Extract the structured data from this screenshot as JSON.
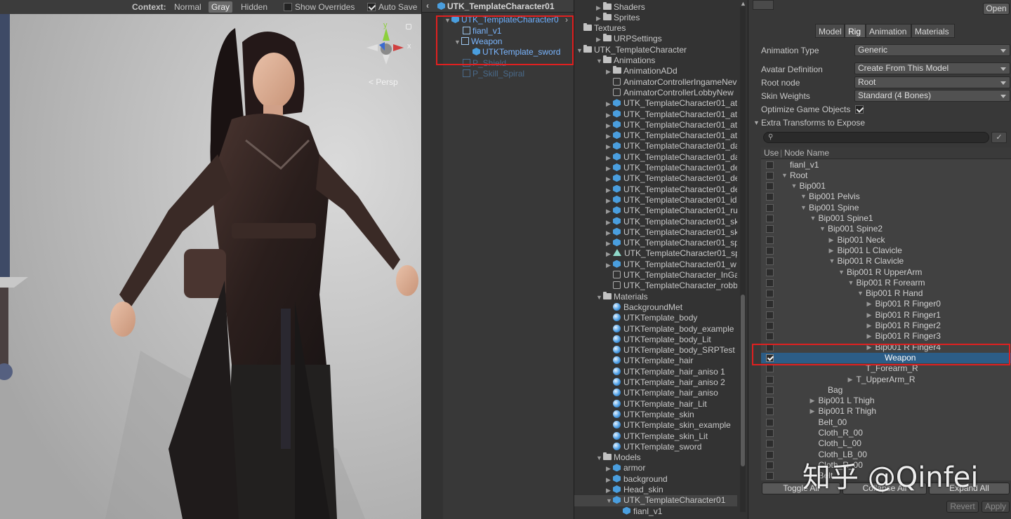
{
  "scene_toolbar": {
    "context_label": "Context:",
    "normal": "Normal",
    "gray": "Gray",
    "hidden": "Hidden",
    "show_overrides": "Show Overrides",
    "auto_save": "Auto Save"
  },
  "gizmo": {
    "x": "x",
    "y": "y",
    "persp": "< Persp"
  },
  "hierarchy": {
    "title": "UTK_TemplateCharacter01",
    "items": [
      {
        "label": "UTK_TemplateCharacter0"
      },
      {
        "label": "fianl_v1"
      },
      {
        "label": "Weapon"
      },
      {
        "label": "UTKTemplate_sword"
      },
      {
        "label": "P_Shield"
      },
      {
        "label": "P_Skill_Spiral"
      }
    ]
  },
  "project": {
    "items": [
      {
        "label": "Shaders"
      },
      {
        "label": "Sprites"
      },
      {
        "label": "Textures"
      },
      {
        "label": "URPSettings"
      },
      {
        "label": "UTK_TemplateCharacter"
      },
      {
        "label": "Animations"
      },
      {
        "label": "AnimationADd"
      },
      {
        "label": "AnimatorControllerIngameNev"
      },
      {
        "label": "AnimatorControllerLobbyNew"
      },
      {
        "label": "UTK_TemplateCharacter01_at"
      },
      {
        "label": "UTK_TemplateCharacter01_at"
      },
      {
        "label": "UTK_TemplateCharacter01_at"
      },
      {
        "label": "UTK_TemplateCharacter01_at"
      },
      {
        "label": "UTK_TemplateCharacter01_da"
      },
      {
        "label": "UTK_TemplateCharacter01_da"
      },
      {
        "label": "UTK_TemplateCharacter01_de"
      },
      {
        "label": "UTK_TemplateCharacter01_de"
      },
      {
        "label": "UTK_TemplateCharacter01_de"
      },
      {
        "label": "UTK_TemplateCharacter01_id"
      },
      {
        "label": "UTK_TemplateCharacter01_ru"
      },
      {
        "label": "UTK_TemplateCharacter01_sk"
      },
      {
        "label": "UTK_TemplateCharacter01_sk"
      },
      {
        "label": "UTK_TemplateCharacter01_sp"
      },
      {
        "label": "UTK_TemplateCharacter01_sp"
      },
      {
        "label": "UTK_TemplateCharacter01_w"
      },
      {
        "label": "UTK_TemplateCharacter_InGa"
      },
      {
        "label": "UTK_TemplateCharacter_robb"
      },
      {
        "label": "Materials"
      },
      {
        "label": "BackgroundMet"
      },
      {
        "label": "UTKTemplate_body"
      },
      {
        "label": "UTKTemplate_body_example"
      },
      {
        "label": "UTKTemplate_body_Lit"
      },
      {
        "label": "UTKTemplate_body_SRPTest"
      },
      {
        "label": "UTKTemplate_hair"
      },
      {
        "label": "UTKTemplate_hair_aniso 1"
      },
      {
        "label": "UTKTemplate_hair_aniso 2"
      },
      {
        "label": "UTKTemplate_hair_aniso"
      },
      {
        "label": "UTKTemplate_hair_Lit"
      },
      {
        "label": "UTKTemplate_skin"
      },
      {
        "label": "UTKTemplate_skin_example"
      },
      {
        "label": "UTKTemplate_skin_Lit"
      },
      {
        "label": "UTKTemplate_sword"
      },
      {
        "label": "Models"
      },
      {
        "label": "armor"
      },
      {
        "label": "background"
      },
      {
        "label": "Head_skin"
      },
      {
        "label": "UTK_TemplateCharacter01"
      },
      {
        "label": "fianl_v1"
      }
    ]
  },
  "inspector": {
    "open_button": "Open",
    "tabs": [
      "Model",
      "Rig",
      "Animation",
      "Materials"
    ],
    "animation_type_label": "Animation Type",
    "animation_type_value": "Generic",
    "avatar_definition_label": "Avatar Definition",
    "avatar_definition_value": "Create From This Model",
    "root_node_label": "Root node",
    "root_node_value": "Root",
    "skin_weights_label": "Skin Weights",
    "skin_weights_value": "Standard (4 Bones)",
    "optimize_label": "Optimize Game Objects",
    "extra_label": "Extra Transforms to Expose",
    "col_use": "Use",
    "col_node": "Node Name",
    "nodes": [
      {
        "label": "fianl_v1"
      },
      {
        "label": "Root"
      },
      {
        "label": "Bip001"
      },
      {
        "label": "Bip001 Pelvis"
      },
      {
        "label": "Bip001 Spine"
      },
      {
        "label": "Bip001 Spine1"
      },
      {
        "label": "Bip001 Spine2"
      },
      {
        "label": "Bip001 Neck"
      },
      {
        "label": "Bip001 L Clavicle"
      },
      {
        "label": "Bip001 R Clavicle"
      },
      {
        "label": "Bip001 R UpperArm"
      },
      {
        "label": "Bip001 R Forearm"
      },
      {
        "label": "Bip001 R Hand"
      },
      {
        "label": "Bip001 R Finger0"
      },
      {
        "label": "Bip001 R Finger1"
      },
      {
        "label": "Bip001 R Finger2"
      },
      {
        "label": "Bip001 R Finger3"
      },
      {
        "label": "Bip001 R Finger4"
      },
      {
        "label": "Weapon"
      },
      {
        "label": "T_Forearm_R"
      },
      {
        "label": "T_UpperArm_R"
      },
      {
        "label": "Bag"
      },
      {
        "label": "Bip001 L Thigh"
      },
      {
        "label": "Bip001 R Thigh"
      },
      {
        "label": "Belt_00"
      },
      {
        "label": "Cloth_R_00"
      },
      {
        "label": "Cloth_L_00"
      },
      {
        "label": "Cloth_LB_00"
      },
      {
        "label": "Cloth_R_00"
      },
      {
        "label": "Belt"
      }
    ],
    "toggle_all": "Toggle All",
    "collapse_all": "Collapse All",
    "expand_all": "Expand All",
    "revert": "Revert",
    "apply": "Apply"
  },
  "watermark": "知乎 @Qinfei"
}
